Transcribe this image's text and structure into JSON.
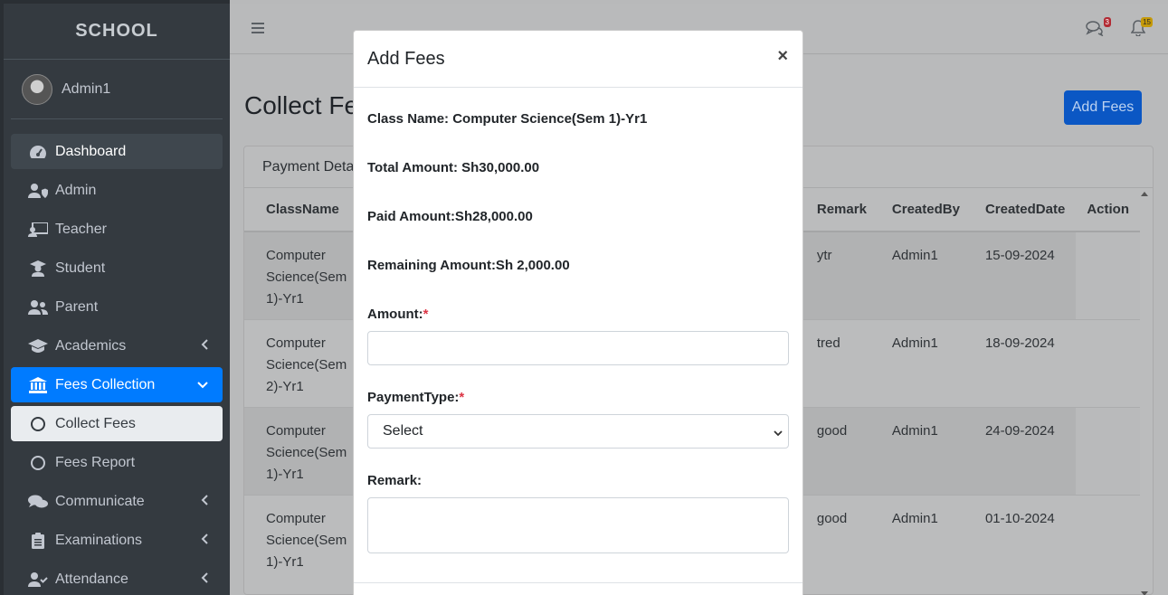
{
  "brand": "SCHOOL",
  "user": {
    "name": "Admin1"
  },
  "sidebar": {
    "items": [
      {
        "label": "Dashboard",
        "icon": "tachometer-icon"
      },
      {
        "label": "Admin",
        "icon": "user-shield-icon"
      },
      {
        "label": "Teacher",
        "icon": "chalkboard-teacher-icon"
      },
      {
        "label": "Student",
        "icon": "graduate-icon"
      },
      {
        "label": "Parent",
        "icon": "users-icon"
      },
      {
        "label": "Academics",
        "icon": "graduation-cap-icon"
      },
      {
        "label": "Fees Collection",
        "icon": "bank-icon"
      },
      {
        "label": "Collect Fees",
        "icon": "circle-icon"
      },
      {
        "label": "Fees Report",
        "icon": "circle-icon"
      },
      {
        "label": "Communicate",
        "icon": "comments-icon"
      },
      {
        "label": "Examinations",
        "icon": "clipboard-icon"
      },
      {
        "label": "Attendance",
        "icon": "user-check-icon"
      }
    ]
  },
  "topbar": {
    "messages_count": "3",
    "notifications_count": "15"
  },
  "page": {
    "title": "Collect Fees",
    "add_button": "Add Fees",
    "card_title": "Payment Details"
  },
  "table": {
    "headers": [
      "ClassName",
      "Remark",
      "CreatedBy",
      "CreatedDate",
      "Action"
    ],
    "rows": [
      {
        "class_l1": "Computer",
        "class_l2": "Science(Sem",
        "class_l3": "1)-Yr1",
        "remark": "ytr",
        "created_by": "Admin1",
        "created_date": "15-09-2024"
      },
      {
        "class_l1": "Computer",
        "class_l2": "Science(Sem",
        "class_l3": "2)-Yr1",
        "remark": "tred",
        "created_by": "Admin1",
        "created_date": "18-09-2024"
      },
      {
        "class_l1": "Computer",
        "class_l2": "Science(Sem",
        "class_l3": "1)-Yr1",
        "remark": "good",
        "created_by": "Admin1",
        "created_date": "24-09-2024"
      },
      {
        "class_l1": "Computer",
        "class_l2": "Science(Sem",
        "class_l3": "1)-Yr1",
        "remark": "good",
        "created_by": "Admin1",
        "created_date": "01-10-2024"
      }
    ]
  },
  "modal": {
    "title": "Add Fees",
    "close": "×",
    "class_name": "Class Name: Computer Science(Sem 1)-Yr1",
    "total_amount": "Total Amount: Sh30,000.00",
    "paid_amount": "Paid Amount:Sh28,000.00",
    "remaining_amount": "Remaining Amount:Sh 2,000.00",
    "amount_label": "Amount:",
    "amount_value": "",
    "payment_type_label": "PaymentType:",
    "payment_type_selected": "Select",
    "remark_label": "Remark:",
    "remark_value": "",
    "required_mark": "*"
  },
  "colors": {
    "primary": "#007bff",
    "sidebar_bg": "#343a40",
    "required": "#dc3545"
  }
}
